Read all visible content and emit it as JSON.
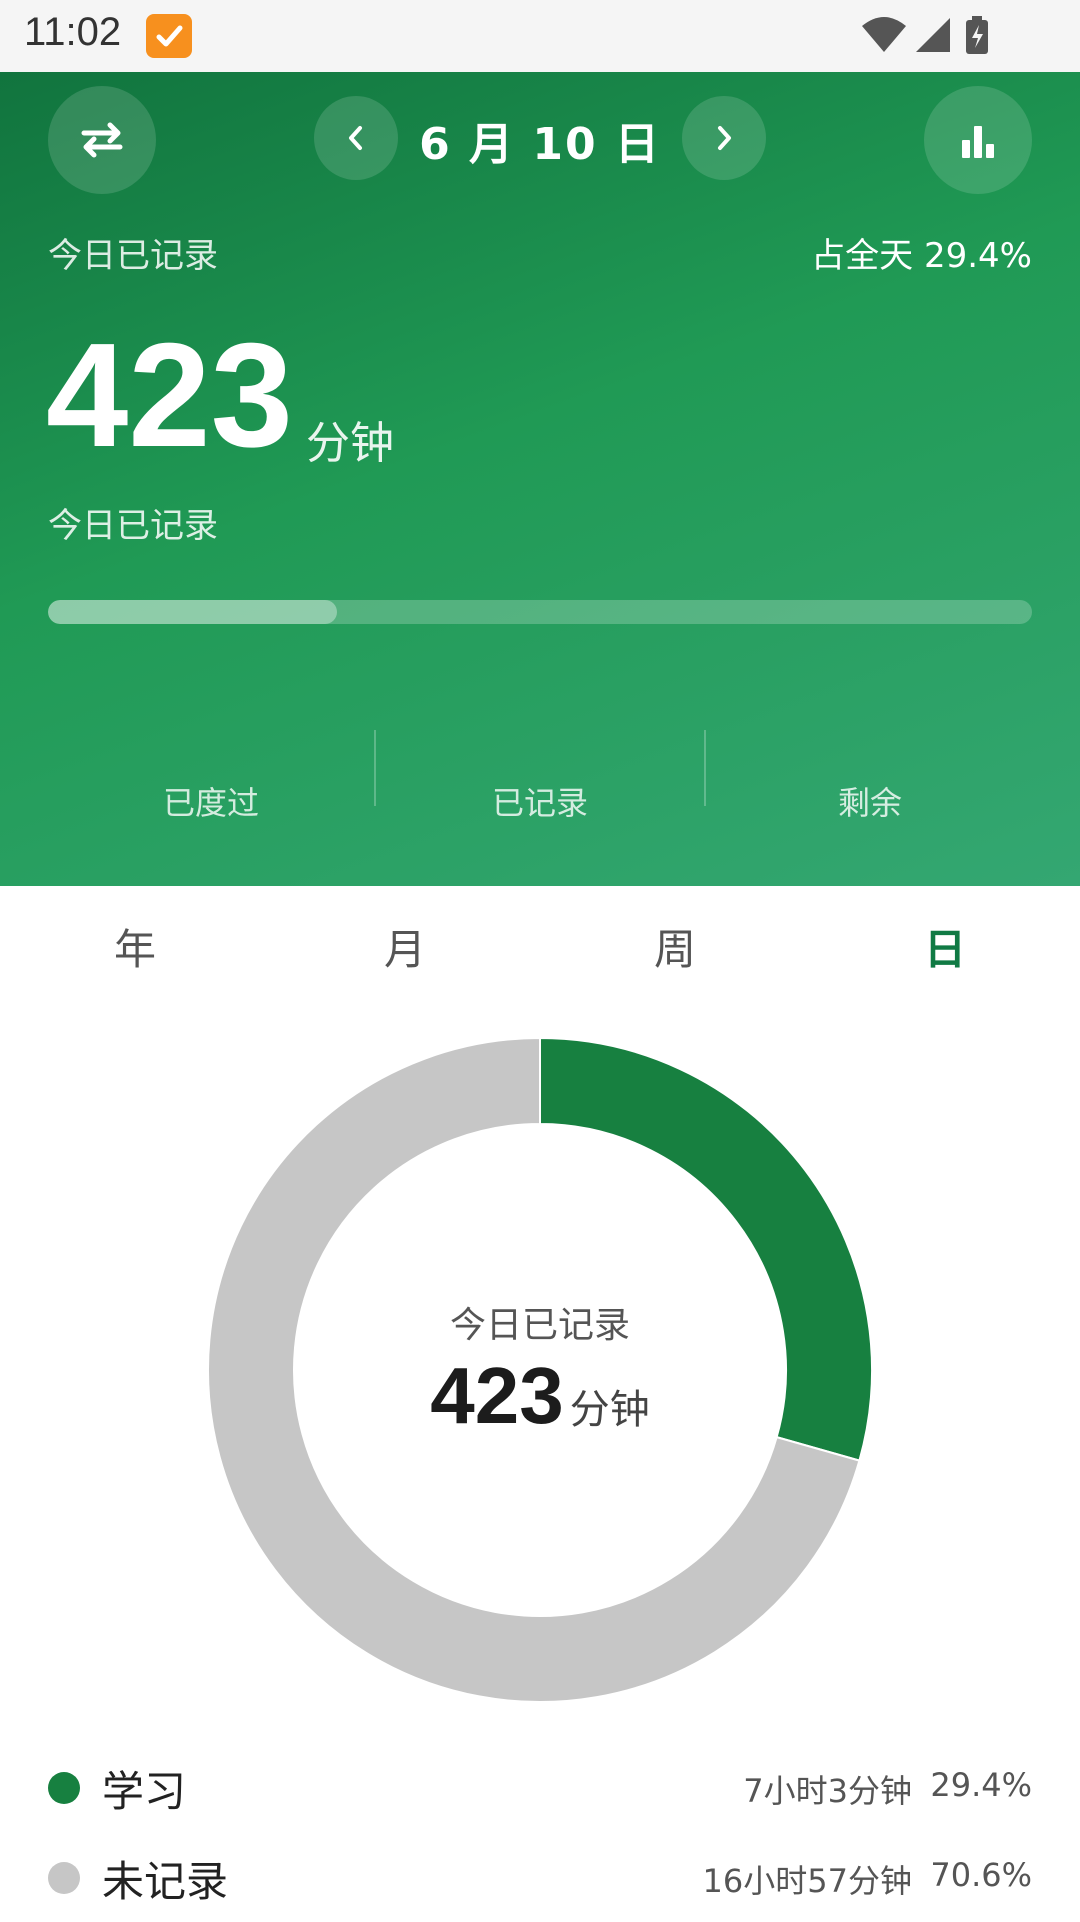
{
  "status_bar": {
    "time": "11:02",
    "icons": [
      "notification-app-icon",
      "wifi-icon",
      "signal-icon",
      "battery-charging-icon"
    ]
  },
  "header": {
    "date": "6 月 10 日",
    "recorded_label_top": "今日已记录",
    "share_of_day": "占全天 29.4%",
    "total_minutes": "423",
    "unit": "分钟",
    "recorded_label_bottom": "今日已记录",
    "progress_fraction": 0.294,
    "stats": [
      "已度过",
      "已记录",
      "剩余"
    ],
    "buttons": [
      "swap-icon",
      "prev-day-icon",
      "next-day-icon",
      "bar-chart-icon"
    ]
  },
  "tabs": {
    "items": [
      "年",
      "月",
      "周",
      "日"
    ],
    "active": "日"
  },
  "donut": {
    "center_label": "今日已记录",
    "center_value": "423",
    "center_unit": "分钟"
  },
  "legend": [
    {
      "name": "学习",
      "duration": "7小时3分钟",
      "percent": "29.4%",
      "color": "#178040"
    },
    {
      "name": "未记录",
      "duration": "16小时57分钟",
      "percent": "70.6%",
      "color": "#c6c6c6"
    }
  ],
  "chart_data": {
    "type": "pie",
    "categories": [
      "学习",
      "未记录"
    ],
    "values": [
      29.4,
      70.6
    ],
    "colors": [
      "#178040",
      "#c6c6c6"
    ]
  },
  "colors": {
    "accent": "#107a44",
    "header_gradient_start": "#11743e",
    "header_gradient_end": "#34a772"
  }
}
